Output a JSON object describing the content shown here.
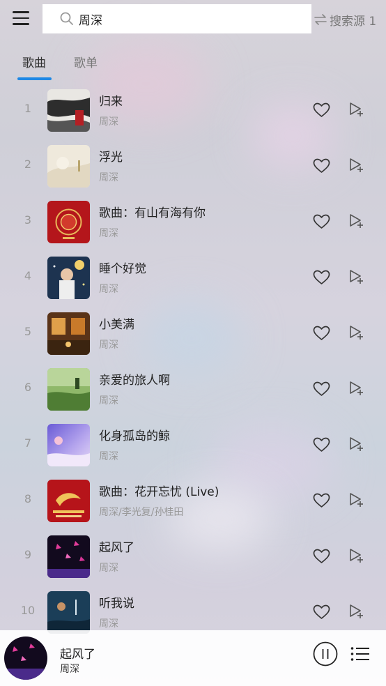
{
  "header": {
    "search_value": "周深",
    "source_label": "搜索源 1"
  },
  "tabs": [
    {
      "label": "歌曲",
      "active": true
    },
    {
      "label": "歌单",
      "active": false
    }
  ],
  "songs": [
    {
      "index": "1",
      "title": "归来",
      "artist": "周深"
    },
    {
      "index": "2",
      "title": "浮光",
      "artist": "周深"
    },
    {
      "index": "3",
      "title": "歌曲：有山有海有你",
      "artist": "周深"
    },
    {
      "index": "4",
      "title": "睡个好觉",
      "artist": "周深"
    },
    {
      "index": "5",
      "title": "小美满",
      "artist": "周深"
    },
    {
      "index": "6",
      "title": "亲爱的旅人啊",
      "artist": "周深"
    },
    {
      "index": "7",
      "title": "化身孤岛的鲸",
      "artist": "周深"
    },
    {
      "index": "8",
      "title": "歌曲：花开忘忧 (Live)",
      "artist": "周深/李光复/孙桂田"
    },
    {
      "index": "9",
      "title": "起风了",
      "artist": "周深"
    },
    {
      "index": "10",
      "title": "听我说",
      "artist": "周深"
    }
  ],
  "player": {
    "title": "起风了",
    "artist": "周深"
  },
  "colors": {
    "accent": "#1e88e5"
  },
  "icons": {
    "menu": "hamburger-menu-icon",
    "search": "search-icon",
    "source": "swap-icon",
    "like": "heart-outline-icon",
    "add": "add-to-queue-icon",
    "pause": "pause-icon",
    "queue": "playlist-icon"
  }
}
